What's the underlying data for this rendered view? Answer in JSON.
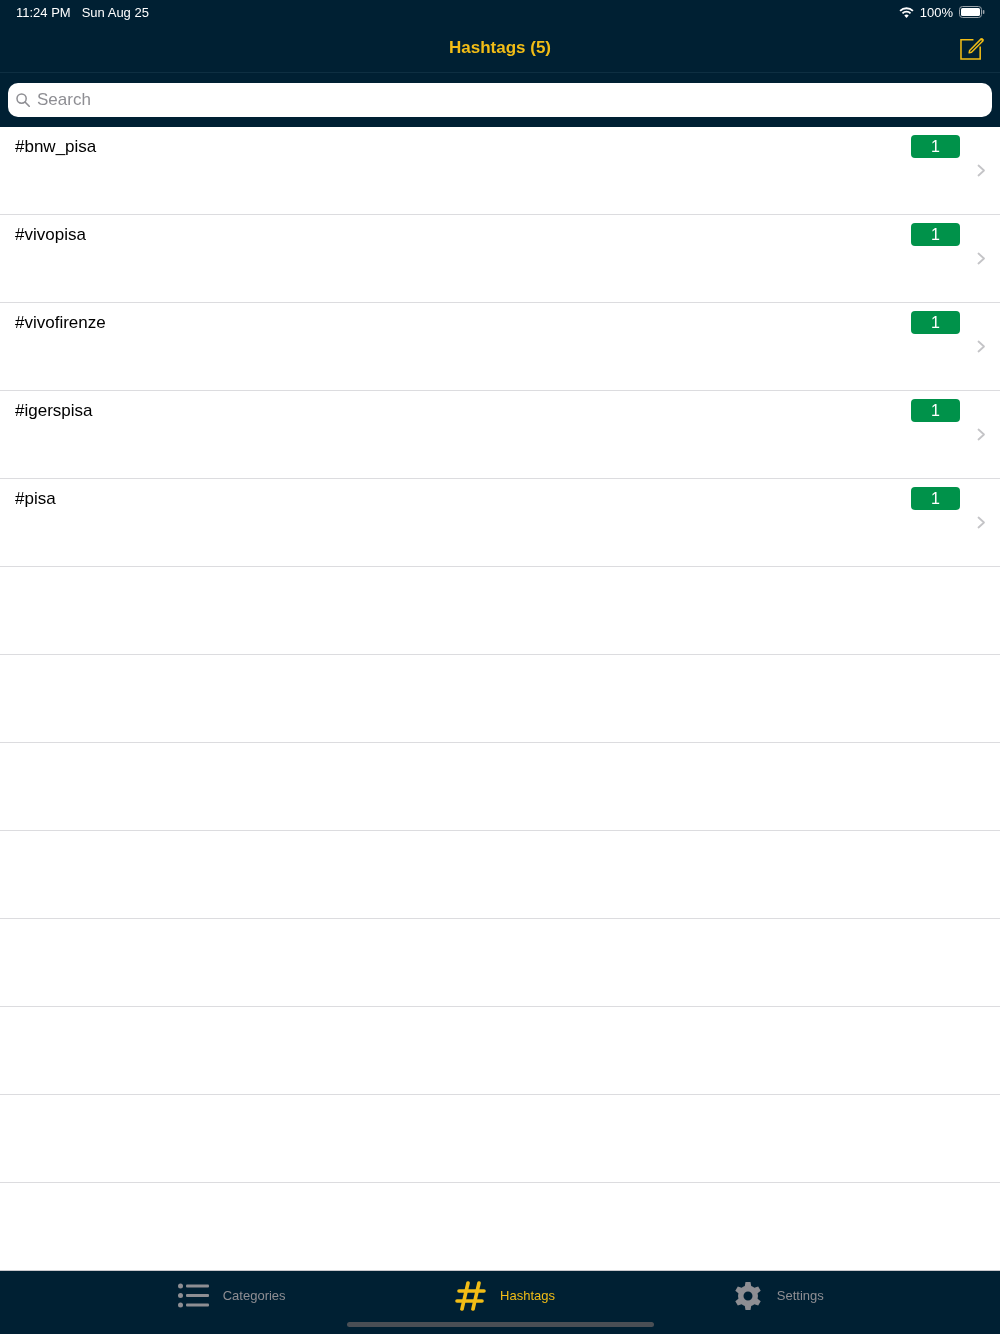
{
  "status_bar": {
    "time": "11:24 PM",
    "date": "Sun Aug 25",
    "battery": "100%"
  },
  "nav_bar": {
    "title": "Hashtags (5)"
  },
  "search": {
    "placeholder": "Search"
  },
  "hashtags": [
    {
      "name": "#bnw_pisa",
      "count": "1"
    },
    {
      "name": "#vivopisa",
      "count": "1"
    },
    {
      "name": "#vivofirenze",
      "count": "1"
    },
    {
      "name": "#igerspisa",
      "count": "1"
    },
    {
      "name": "#pisa",
      "count": "1"
    }
  ],
  "tab_bar": {
    "tabs": [
      {
        "label": "Categories",
        "kind": "list",
        "selected": false
      },
      {
        "label": "Hashtags",
        "kind": "hash",
        "selected": true
      },
      {
        "label": "Settings",
        "kind": "gear",
        "selected": false
      }
    ]
  }
}
